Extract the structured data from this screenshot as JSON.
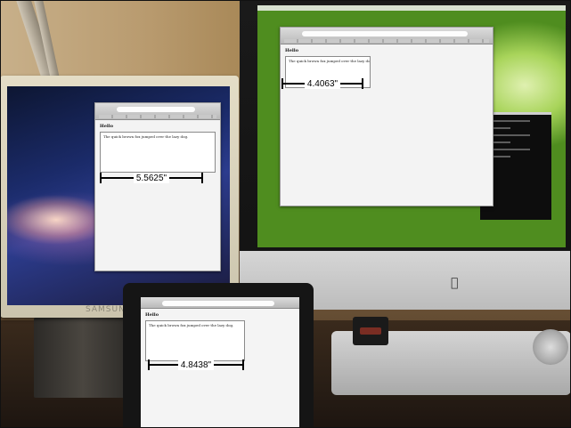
{
  "left_monitor": {
    "brand": "SAMSUNG",
    "browser": {
      "heading": "Hello",
      "text": "The quick brown fox jumped over the lazy dog."
    },
    "measurement": "5.5625\""
  },
  "imac": {
    "browser": {
      "heading": "Hello",
      "text": "The quick brown fox jumped over the lazy dog."
    },
    "measurement": "4.4063\""
  },
  "ipad": {
    "browser": {
      "heading": "Hello",
      "text": "The quick brown fox jumped over the lazy dog."
    },
    "measurement": "4.8438\""
  },
  "colors": {
    "measurement_bar": "#000000",
    "measurement_label_bg": "#ffffff",
    "imac_wallpaper": "#4e9a22",
    "samsung_wallpaper": "#1b2b6a"
  },
  "icons": [
    "apple-logo-icon"
  ]
}
